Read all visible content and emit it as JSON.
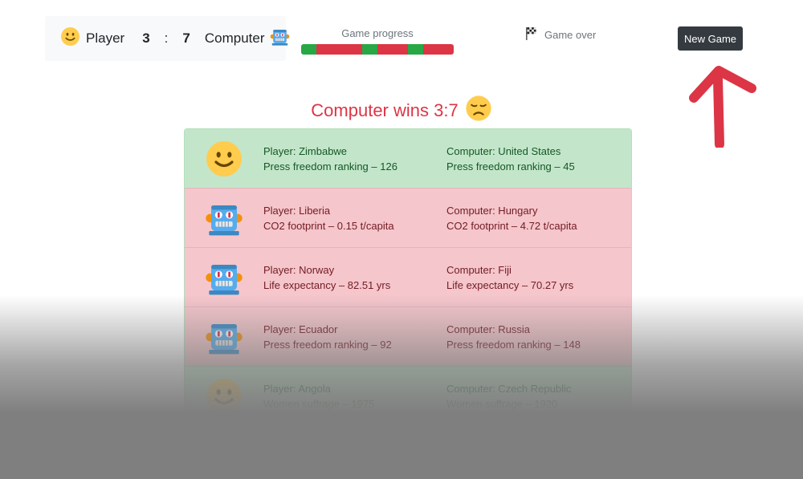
{
  "score": {
    "player_label": "Player",
    "player_score": "3",
    "separator": ":",
    "computer_score": "7",
    "computer_label": "Computer"
  },
  "progress": {
    "label": "Game progress",
    "segments": [
      "win",
      "loss",
      "loss",
      "loss",
      "win",
      "loss",
      "loss",
      "win",
      "loss",
      "loss"
    ]
  },
  "status": {
    "text": "Game over",
    "icon": "checkered-flag-icon"
  },
  "new_game_label": "New Game",
  "result": {
    "text": "Computer wins 3:7",
    "icon": "disappointed-face-icon"
  },
  "colors": {
    "win_bg": "#c3e6cb",
    "win_text": "#155724",
    "loss_bg": "#f5c6cb",
    "loss_text": "#721c24",
    "progress_win": "#28a745",
    "progress_loss": "#dc3545",
    "result_text": "#dc3545",
    "button_bg": "#343a40",
    "arrow": "#dc3545"
  },
  "rounds": [
    {
      "outcome": "win",
      "icon": "smiling-face-icon",
      "player": "Player: Zimbabwe",
      "player_stat": "Press freedom ranking – 126",
      "computer": "Computer: United States",
      "computer_stat": "Press freedom ranking – 45"
    },
    {
      "outcome": "loss",
      "icon": "robot-icon",
      "player": "Player: Liberia",
      "player_stat": "CO2 footprint – 0.15 t/capita",
      "computer": "Computer: Hungary",
      "computer_stat": "CO2 footprint – 4.72 t/capita"
    },
    {
      "outcome": "loss",
      "icon": "robot-icon",
      "player": "Player: Norway",
      "player_stat": "Life expectancy – 82.51 yrs",
      "computer": "Computer: Fiji",
      "computer_stat": "Life expectancy – 70.27 yrs"
    },
    {
      "outcome": "loss",
      "icon": "robot-icon",
      "player": "Player: Ecuador",
      "player_stat": "Press freedom ranking – 92",
      "computer": "Computer: Russia",
      "computer_stat": "Press freedom ranking – 148"
    },
    {
      "outcome": "win",
      "icon": "smiling-face-icon",
      "player": "Player: Angola",
      "player_stat": "Women suffrage – 1975",
      "computer": "Computer: Czech Republic",
      "computer_stat": "Women suffrage – 1920"
    }
  ]
}
